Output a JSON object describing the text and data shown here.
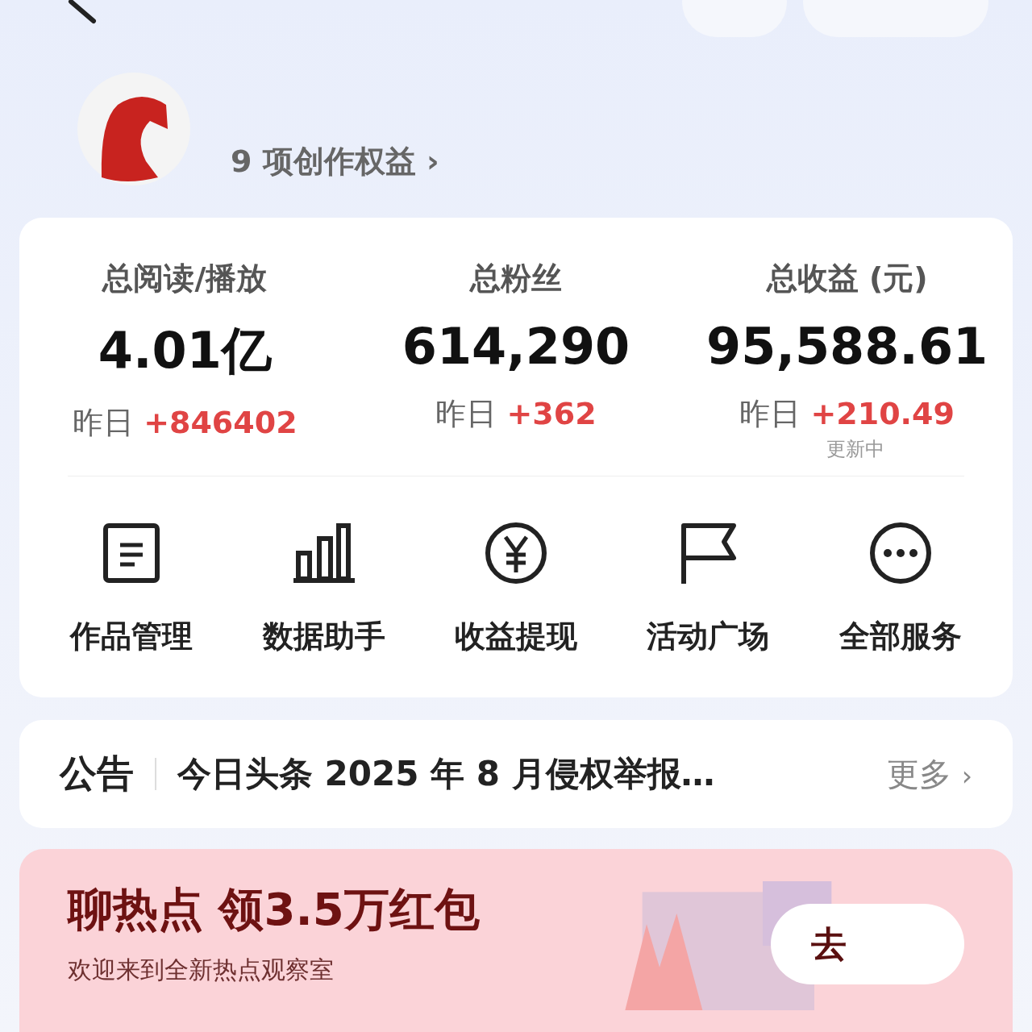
{
  "profile": {
    "benefits": "9 项创作权益",
    "chevron": "›"
  },
  "stats": [
    {
      "label": "总阅读/播放",
      "value": "4.01亿",
      "prefix": "昨日",
      "delta": "+846402"
    },
    {
      "label": "总粉丝",
      "value": "614,290",
      "prefix": "昨日",
      "delta": "+362"
    },
    {
      "label": "总收益 (元)",
      "value": "95,588.61",
      "prefix": "昨日",
      "delta": "+210.49",
      "note": "更新中"
    }
  ],
  "tools": [
    {
      "kind": "doc",
      "label": "作品管理"
    },
    {
      "kind": "chart",
      "label": "数据助手"
    },
    {
      "kind": "yen",
      "label": "收益提现"
    },
    {
      "kind": "flag",
      "label": "活动广场"
    },
    {
      "kind": "more",
      "label": "全部服务"
    }
  ],
  "notice": {
    "tag": "公告",
    "text": "今日头条 2025 年 8 月侵权举报…",
    "more": "更多",
    "chevron": "›"
  },
  "banner": {
    "title": "聊热点 领3.5万红包",
    "subtitle": "欢迎来到全新热点观察室",
    "button": "去"
  }
}
